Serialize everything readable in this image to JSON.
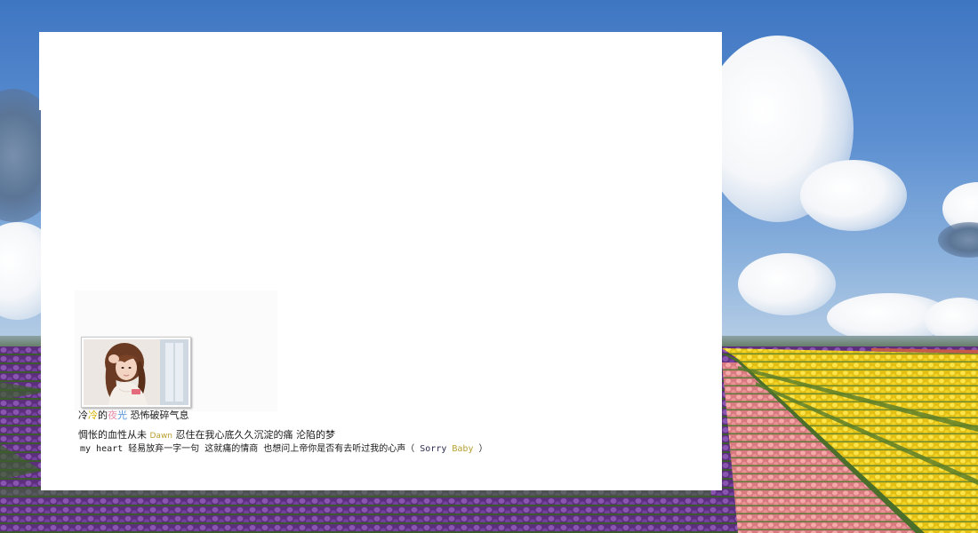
{
  "background": {
    "description_icon": "tulip-field-landscape",
    "sky_color": "#4f82c8",
    "tulip_colors": [
      "#6a3a8c",
      "#e48a8f",
      "#f2d21e"
    ]
  },
  "photo": {
    "icon": "girl-portrait-photo"
  },
  "poem": {
    "line1": {
      "part1": "冷",
      "part2": "冷",
      "part3": "的",
      "part4": "夜",
      "part5": "光",
      "part6": " 恐怖破碎气息"
    },
    "line2": {
      "part1": "惆怅的血性从未 ",
      "part2": "Dawn",
      "part3": " 忍住在我心底久久沉淀的痛  沦陷的梦"
    },
    "line3": {
      "part1": "my heart 轻易放弃一字一句 这就痛的情商 也想问上帝你是否有去听过我的心声（",
      "part2": " Sorry ",
      "part3": "Baby",
      "part4": " ）"
    }
  },
  "colors": {
    "accent_yellow": "#d9b300",
    "accent_pink": "#e68fa8",
    "accent_blue": "#4f8fd6",
    "text": "#1a1a1a"
  }
}
